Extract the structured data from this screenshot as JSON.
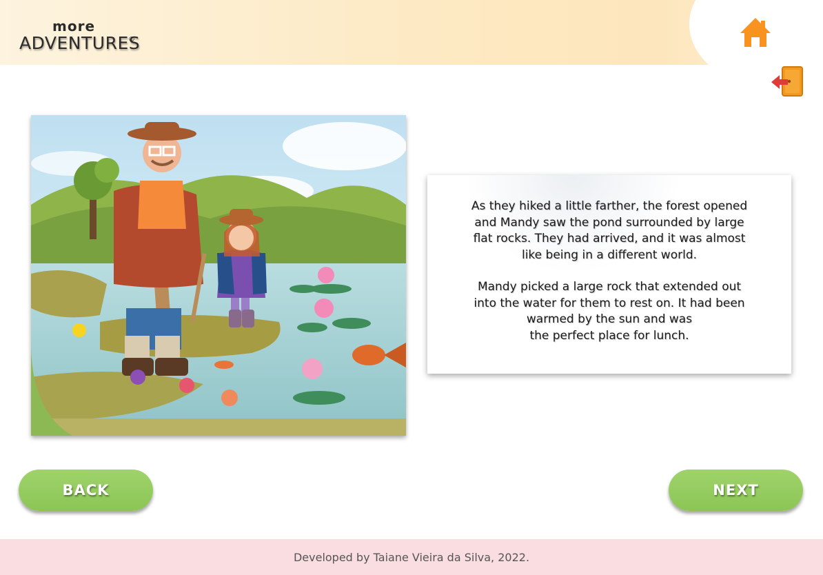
{
  "header": {
    "logo_top": "more",
    "logo_main": "ADVENTURES",
    "logo_mark": "©",
    "home_icon": "home-icon",
    "exit_icon": "exit-door-icon"
  },
  "story": {
    "paragraphs": [
      "As they hiked a little farther, the forest opened\nand Mandy saw the pond surrounded by large\nflat rocks. They had arrived, and it was almost\nlike being in a different world.",
      "Mandy picked a large rock that extended out\ninto the water for them to rest on. It had been\nwarmed by the sun and was\nthe perfect place for lunch."
    ]
  },
  "nav": {
    "back_label": "BACK",
    "next_label": "NEXT"
  },
  "footer": {
    "credit": "Developed by Taiane Vieira da Silva, 2022."
  },
  "colors": {
    "button_green": "#9fd36a",
    "home_orange": "#f7931e",
    "footer_pink": "#f9dde1",
    "header_cream": "#fde9c2"
  }
}
